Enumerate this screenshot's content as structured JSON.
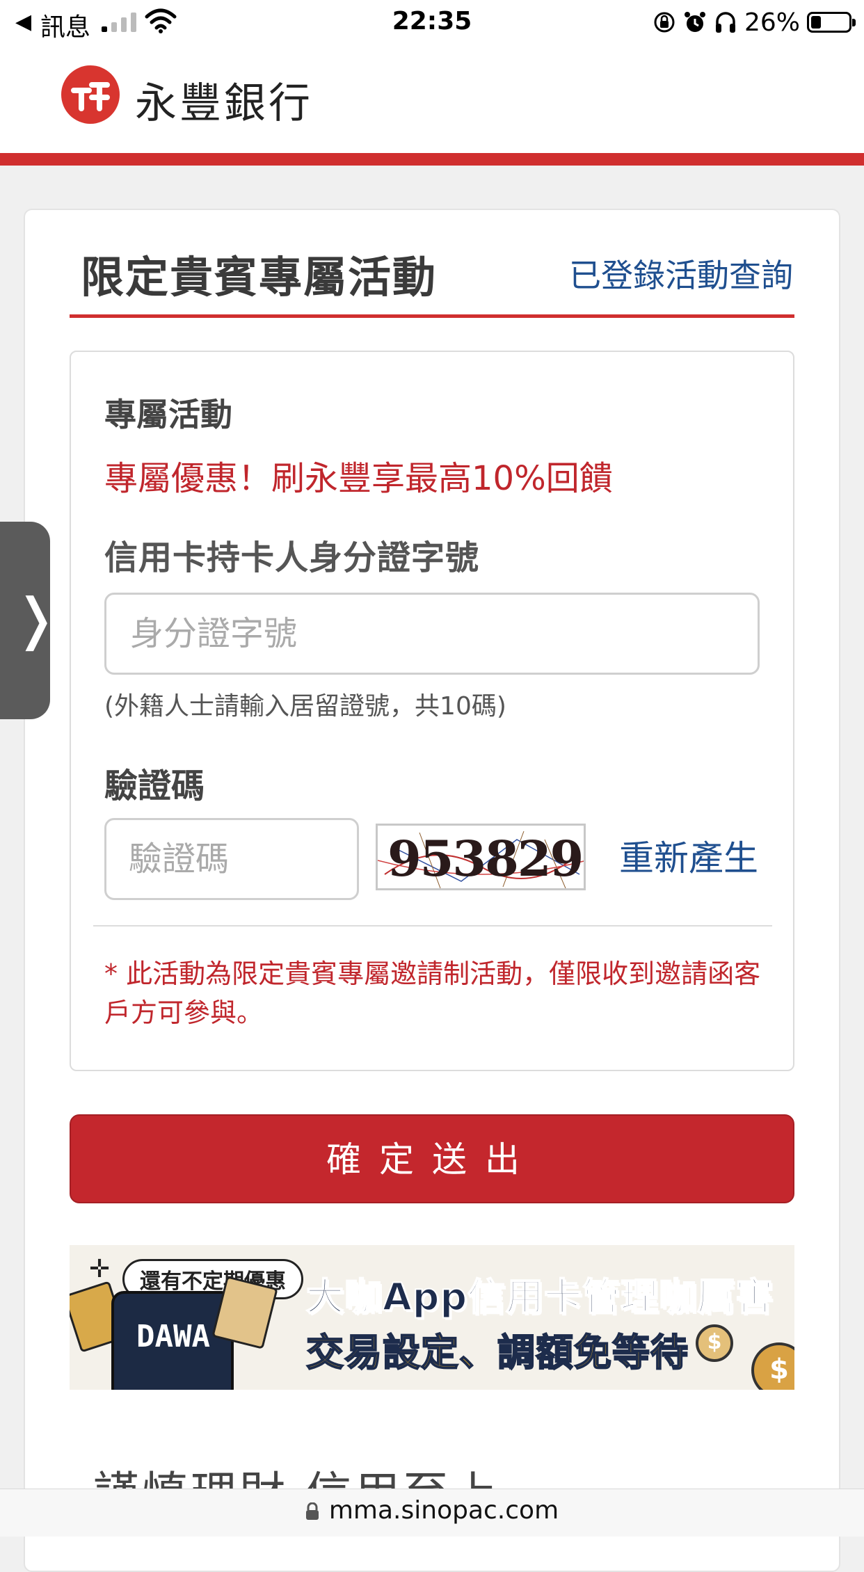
{
  "status_bar": {
    "back_label": "◀",
    "carrier": "訊息",
    "time": "22:35",
    "battery_percent": "26%",
    "battery_level": 0.26
  },
  "header": {
    "brand": "永豐銀行"
  },
  "page": {
    "title": "限定貴賓專屬活動",
    "query_link": "已登錄活動查詢"
  },
  "form": {
    "section_label": "專屬活動",
    "promo_text": "專屬優惠！刷永豐享最高10%回饋",
    "id_label": "信用卡持卡人身分證字號",
    "id_placeholder": "身分證字號",
    "id_value": "",
    "id_hint": "(外籍人士請輸入居留證號，共10碼)",
    "captcha_label": "驗證碼",
    "captcha_placeholder": "驗證碼",
    "captcha_value": "",
    "captcha_image_text": "953829",
    "regenerate_label": "重新產生",
    "notice": "* 此活動為限定貴賓專屬邀請制活動，僅限收到邀請函客戶方可參與。",
    "submit_label": "確定送出"
  },
  "banner": {
    "bubble_text": "還有不定期優惠",
    "app_mark": "DAWA",
    "line1": "大咖App信用卡管理咖厲害",
    "line2": "交易設定、調額免等待"
  },
  "below": {
    "heading_partial": "謹慎理財 信用至上"
  },
  "url_bar": {
    "url": "mma.sinopac.com"
  },
  "colors": {
    "brand_red": "#c4272d",
    "link_blue": "#1f4f8f"
  }
}
